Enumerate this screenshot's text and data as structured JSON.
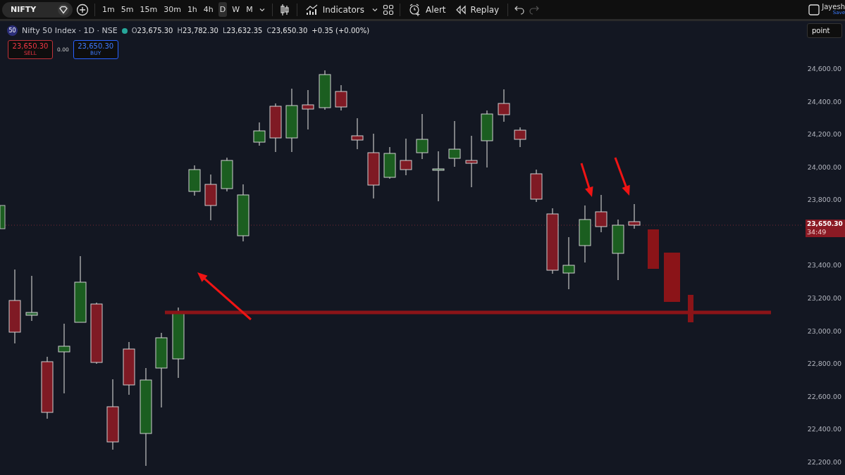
{
  "toolbar": {
    "symbol": "NIFTY",
    "intervals": [
      {
        "label": "1m",
        "selected": false
      },
      {
        "label": "5m",
        "selected": false
      },
      {
        "label": "15m",
        "selected": false
      },
      {
        "label": "30m",
        "selected": false
      },
      {
        "label": "1h",
        "selected": false
      },
      {
        "label": "4h",
        "selected": false
      },
      {
        "label": "D",
        "selected": true
      },
      {
        "label": "W",
        "selected": false
      },
      {
        "label": "M",
        "selected": false
      }
    ],
    "indicators_label": "Indicators",
    "alert_label": "Alert",
    "replay_label": "Replay",
    "redo": {
      "disabled": true
    },
    "user": "Jayesh",
    "save_label": "Save"
  },
  "legend": {
    "badge": "50",
    "title": "Nifty 50 Index · 1D · NSE",
    "ohlc": [
      {
        "key": "O",
        "value": "23,675.30"
      },
      {
        "key": "H",
        "value": "23,782.30"
      },
      {
        "key": "L",
        "value": "23,632.35"
      },
      {
        "key": "C",
        "value": "23,650.30"
      }
    ],
    "change": "+0.35 (+0.00%)"
  },
  "trade": {
    "sell_price": "23,650.30",
    "sell_label": "SELL",
    "spread": "0.00",
    "buy_price": "23,650.30",
    "buy_label": "BUY"
  },
  "price_axis": {
    "scale_mode": "point",
    "labels": [
      "24,600.00",
      "24,400.00",
      "24,200.00",
      "24,000.00",
      "23,800.00",
      "23,400.00",
      "23,200.00",
      "23,000.00",
      "22,800.00",
      "22,600.00",
      "22,400.00",
      "22,200.00"
    ],
    "last_price": "23,650.30",
    "countdown": "34:49"
  }
}
